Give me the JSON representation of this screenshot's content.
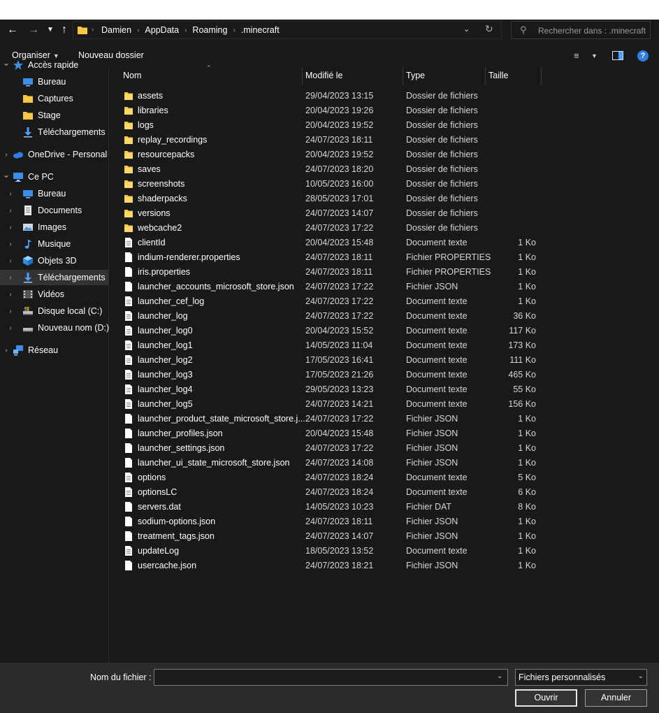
{
  "address": {
    "crumbs": [
      "Damien",
      "AppData",
      "Roaming",
      ".minecraft"
    ]
  },
  "search": {
    "placeholder": "Rechercher dans : .minecraft"
  },
  "toolbar": {
    "organize": "Organiser",
    "new_folder": "Nouveau dossier",
    "help": "?"
  },
  "nav": {
    "items": [
      {
        "label": "Accès rapide",
        "icon": "star-icon",
        "level": 0,
        "expander": "open"
      },
      {
        "label": "Bureau",
        "icon": "desktop-icon",
        "level": 1,
        "expander": "none"
      },
      {
        "label": "Captures",
        "icon": "folder-icon",
        "level": 1,
        "expander": "none"
      },
      {
        "label": "Stage",
        "icon": "folder-icon",
        "level": 1,
        "expander": "none"
      },
      {
        "label": "Téléchargements",
        "icon": "download-icon",
        "level": 1,
        "expander": "none"
      },
      {
        "label": "OneDrive - Personal",
        "icon": "cloud-icon",
        "level": 0,
        "expander": "closed"
      },
      {
        "label": "Ce PC",
        "icon": "pc-icon",
        "level": 0,
        "expander": "open"
      },
      {
        "label": "Bureau",
        "icon": "desktop-icon",
        "level": 1,
        "expander": "closed"
      },
      {
        "label": "Documents",
        "icon": "documents-icon",
        "level": 1,
        "expander": "closed"
      },
      {
        "label": "Images",
        "icon": "images-icon",
        "level": 1,
        "expander": "closed"
      },
      {
        "label": "Musique",
        "icon": "music-icon",
        "level": 1,
        "expander": "closed"
      },
      {
        "label": "Objets 3D",
        "icon": "cube-icon",
        "level": 1,
        "expander": "closed"
      },
      {
        "label": "Téléchargements",
        "icon": "download-icon",
        "level": 1,
        "expander": "closed",
        "selected": true
      },
      {
        "label": "Vidéos",
        "icon": "video-icon",
        "level": 1,
        "expander": "closed"
      },
      {
        "label": "Disque local (C:)",
        "icon": "drive-c-icon",
        "level": 1,
        "expander": "closed"
      },
      {
        "label": "Nouveau nom (D:)",
        "icon": "drive-icon",
        "level": 1,
        "expander": "closed"
      },
      {
        "label": "Réseau",
        "icon": "network-icon",
        "level": 0,
        "expander": "closed"
      }
    ]
  },
  "columns": {
    "name": "Nom",
    "modified": "Modifié le",
    "type": "Type",
    "size": "Taille"
  },
  "files": [
    {
      "name": "assets",
      "date": "29/04/2023 13:15",
      "type": "Dossier de fichiers",
      "size": "",
      "kind": "folder"
    },
    {
      "name": "libraries",
      "date": "20/04/2023 19:26",
      "type": "Dossier de fichiers",
      "size": "",
      "kind": "folder"
    },
    {
      "name": "logs",
      "date": "20/04/2023 19:52",
      "type": "Dossier de fichiers",
      "size": "",
      "kind": "folder"
    },
    {
      "name": "replay_recordings",
      "date": "24/07/2023 18:11",
      "type": "Dossier de fichiers",
      "size": "",
      "kind": "folder"
    },
    {
      "name": "resourcepacks",
      "date": "20/04/2023 19:52",
      "type": "Dossier de fichiers",
      "size": "",
      "kind": "folder"
    },
    {
      "name": "saves",
      "date": "24/07/2023 18:20",
      "type": "Dossier de fichiers",
      "size": "",
      "kind": "folder"
    },
    {
      "name": "screenshots",
      "date": "10/05/2023 16:00",
      "type": "Dossier de fichiers",
      "size": "",
      "kind": "folder"
    },
    {
      "name": "shaderpacks",
      "date": "28/05/2023 17:01",
      "type": "Dossier de fichiers",
      "size": "",
      "kind": "folder"
    },
    {
      "name": "versions",
      "date": "24/07/2023 14:07",
      "type": "Dossier de fichiers",
      "size": "",
      "kind": "folder"
    },
    {
      "name": "webcache2",
      "date": "24/07/2023 17:22",
      "type": "Dossier de fichiers",
      "size": "",
      "kind": "folder"
    },
    {
      "name": "clientId",
      "date": "20/04/2023 15:48",
      "type": "Document texte",
      "size": "1 Ko",
      "kind": "text"
    },
    {
      "name": "indium-renderer.properties",
      "date": "24/07/2023 18:11",
      "type": "Fichier PROPERTIES",
      "size": "1 Ko",
      "kind": "file"
    },
    {
      "name": "iris.properties",
      "date": "24/07/2023 18:11",
      "type": "Fichier PROPERTIES",
      "size": "1 Ko",
      "kind": "file"
    },
    {
      "name": "launcher_accounts_microsoft_store.json",
      "date": "24/07/2023 17:22",
      "type": "Fichier JSON",
      "size": "1 Ko",
      "kind": "file"
    },
    {
      "name": "launcher_cef_log",
      "date": "24/07/2023 17:22",
      "type": "Document texte",
      "size": "1 Ko",
      "kind": "text"
    },
    {
      "name": "launcher_log",
      "date": "24/07/2023 17:22",
      "type": "Document texte",
      "size": "36 Ko",
      "kind": "text"
    },
    {
      "name": "launcher_log0",
      "date": "20/04/2023 15:52",
      "type": "Document texte",
      "size": "117 Ko",
      "kind": "text"
    },
    {
      "name": "launcher_log1",
      "date": "14/05/2023 11:04",
      "type": "Document texte",
      "size": "173 Ko",
      "kind": "text"
    },
    {
      "name": "launcher_log2",
      "date": "17/05/2023 16:41",
      "type": "Document texte",
      "size": "111 Ko",
      "kind": "text"
    },
    {
      "name": "launcher_log3",
      "date": "17/05/2023 21:26",
      "type": "Document texte",
      "size": "465 Ko",
      "kind": "text"
    },
    {
      "name": "launcher_log4",
      "date": "29/05/2023 13:23",
      "type": "Document texte",
      "size": "55 Ko",
      "kind": "text"
    },
    {
      "name": "launcher_log5",
      "date": "24/07/2023 14:21",
      "type": "Document texte",
      "size": "156 Ko",
      "kind": "text"
    },
    {
      "name": "launcher_product_state_microsoft_store.j...",
      "date": "24/07/2023 17:22",
      "type": "Fichier JSON",
      "size": "1 Ko",
      "kind": "file"
    },
    {
      "name": "launcher_profiles.json",
      "date": "20/04/2023 15:48",
      "type": "Fichier JSON",
      "size": "1 Ko",
      "kind": "file"
    },
    {
      "name": "launcher_settings.json",
      "date": "24/07/2023 17:22",
      "type": "Fichier JSON",
      "size": "1 Ko",
      "kind": "file"
    },
    {
      "name": "launcher_ui_state_microsoft_store.json",
      "date": "24/07/2023 14:08",
      "type": "Fichier JSON",
      "size": "1 Ko",
      "kind": "file"
    },
    {
      "name": "options",
      "date": "24/07/2023 18:24",
      "type": "Document texte",
      "size": "5 Ko",
      "kind": "text"
    },
    {
      "name": "optionsLC",
      "date": "24/07/2023 18:24",
      "type": "Document texte",
      "size": "6 Ko",
      "kind": "text"
    },
    {
      "name": "servers.dat",
      "date": "14/05/2023 10:23",
      "type": "Fichier DAT",
      "size": "8 Ko",
      "kind": "file"
    },
    {
      "name": "sodium-options.json",
      "date": "24/07/2023 18:11",
      "type": "Fichier JSON",
      "size": "1 Ko",
      "kind": "file"
    },
    {
      "name": "treatment_tags.json",
      "date": "24/07/2023 14:07",
      "type": "Fichier JSON",
      "size": "1 Ko",
      "kind": "file"
    },
    {
      "name": "updateLog",
      "date": "18/05/2023 13:52",
      "type": "Document texte",
      "size": "1 Ko",
      "kind": "text"
    },
    {
      "name": "usercache.json",
      "date": "24/07/2023 18:21",
      "type": "Fichier JSON",
      "size": "1 Ko",
      "kind": "file"
    }
  ],
  "bottom": {
    "filename_label": "Nom du fichier :",
    "filename_value": "",
    "filetype": "Fichiers personnalisés",
    "open": "Ouvrir",
    "cancel": "Annuler"
  }
}
